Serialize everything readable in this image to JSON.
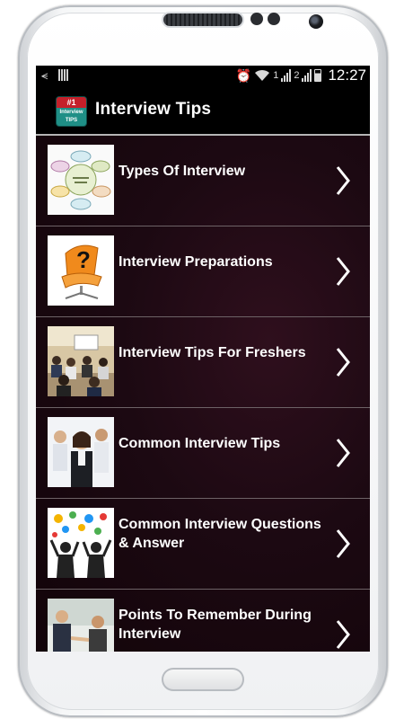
{
  "status_bar": {
    "sim1": "1",
    "sim2": "2",
    "time": "12:27"
  },
  "app_bar": {
    "logo_top": "#1",
    "logo_line1": "Interview",
    "logo_line2": "TIPS",
    "title": "Interview Tips"
  },
  "menu": {
    "items": [
      {
        "label": "Types Of Interview",
        "thumb": "types-of-interview-diagram"
      },
      {
        "label": "Interview Preparations",
        "thumb": "question-chair"
      },
      {
        "label": "Interview Tips For Freshers",
        "thumb": "classroom"
      },
      {
        "label": "Common Interview Tips",
        "thumb": "business-people"
      },
      {
        "label": "Common Interview Questions & Answer",
        "thumb": "people-gears"
      },
      {
        "label": "Points To Remember During Interview",
        "thumb": "handshake"
      }
    ]
  },
  "colors": {
    "app_bar_bg": "#000000",
    "list_bg": "#1c0912",
    "divider": "#6d6266",
    "text": "#ffffff"
  }
}
